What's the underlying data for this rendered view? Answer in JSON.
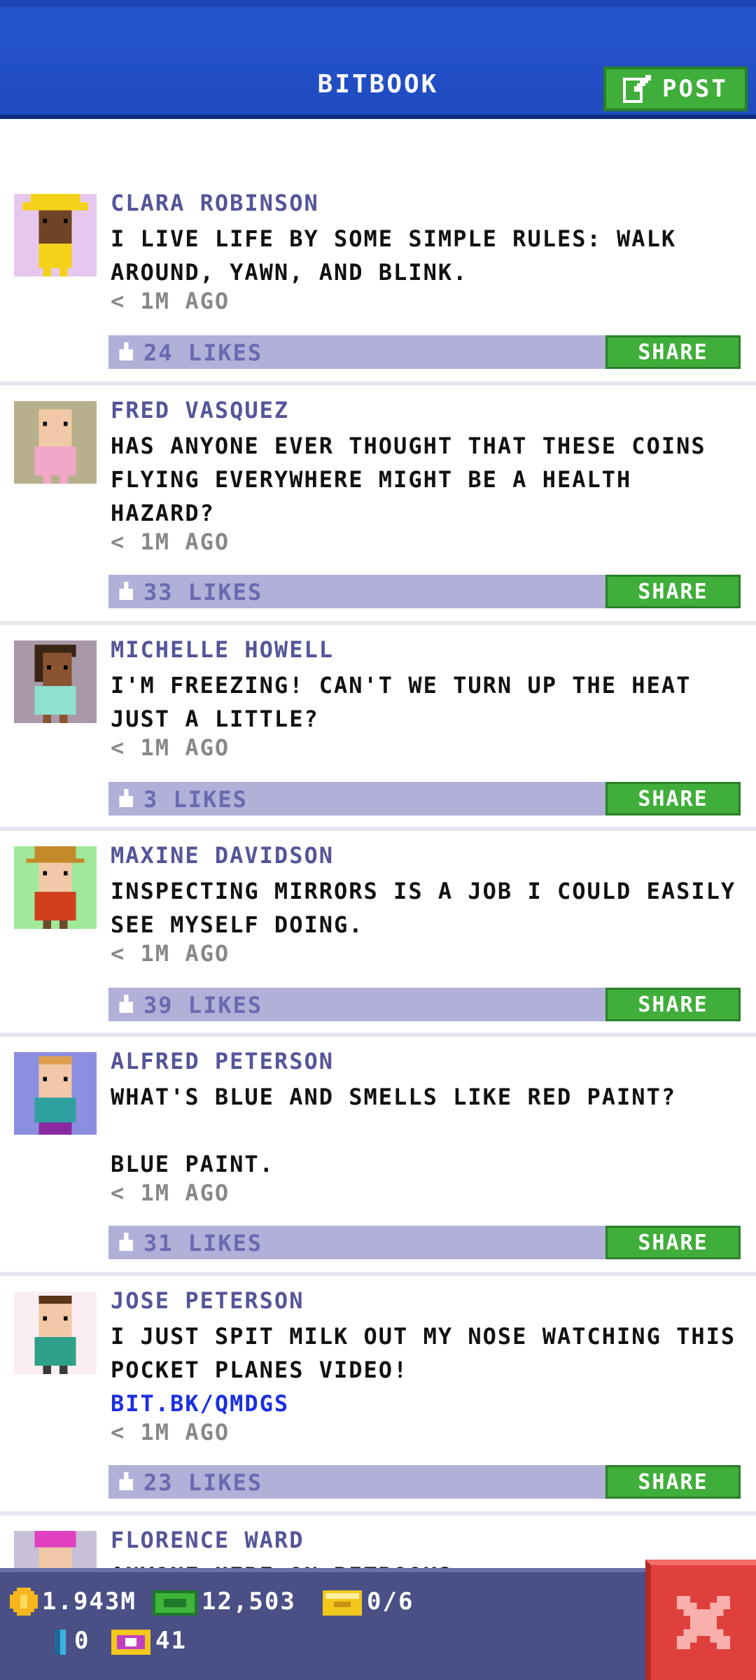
{
  "header": {
    "title": "BITBOOK",
    "post_label": "POST"
  },
  "posts": [
    {
      "author": "CLARA ROBINSON",
      "message": "I LIVE LIFE BY SOME SIMPLE RULES: WALK AROUND, YAWN, AND BLINK.",
      "link": "",
      "time": "< 1M AGO",
      "likes": "24 LIKES",
      "share_label": "SHARE",
      "avatar_bg": "#e6c8ee"
    },
    {
      "author": "FRED VASQUEZ",
      "message": "HAS ANYONE EVER THOUGHT THAT THESE COINS FLYING EVERYWHERE MIGHT BE A HEALTH HAZARD?",
      "link": "",
      "time": "< 1M AGO",
      "likes": "33 LIKES",
      "share_label": "SHARE",
      "avatar_bg": "#b8b08c"
    },
    {
      "author": "MICHELLE HOWELL",
      "message": "I'M FREEZING! CAN'T WE TURN UP THE HEAT JUST A LITTLE?",
      "link": "",
      "time": "< 1M AGO",
      "likes": "3 LIKES",
      "share_label": "SHARE",
      "avatar_bg": "#a898a8"
    },
    {
      "author": "MAXINE DAVIDSON",
      "message": "INSPECTING MIRRORS IS A JOB I COULD EASILY SEE MYSELF DOING.",
      "link": "",
      "time": "< 1M AGO",
      "likes": "39 LIKES",
      "share_label": "SHARE",
      "avatar_bg": "#a0e89a"
    },
    {
      "author": "ALFRED PETERSON",
      "message": "WHAT'S BLUE AND SMELLS LIKE RED PAINT?\n\nBLUE PAINT.",
      "link": "",
      "time": "< 1M AGO",
      "likes": "31 LIKES",
      "share_label": "SHARE",
      "avatar_bg": "#8c8ee0"
    },
    {
      "author": "JOSE PETERSON",
      "message": "I JUST SPIT MILK OUT MY NOSE WATCHING THIS POCKET PLANES VIDEO!",
      "link": "BIT.BK/QMDGS",
      "time": "< 1M AGO",
      "likes": "23 LIKES",
      "share_label": "SHARE",
      "avatar_bg": "#fbeef2"
    },
    {
      "author": "FLORENCE WARD",
      "message": "ANYONE HERE ON BITBOOK?",
      "link": "",
      "time": "",
      "likes": "",
      "share_label": "",
      "avatar_bg": "#c8c0d8"
    }
  ],
  "status": {
    "coins": "1.943M",
    "bux": "12,503",
    "tickets": "0/6",
    "keys": "0",
    "vip": "41"
  },
  "colors": {
    "header": "#1f4bbf",
    "share_green": "#3fae3a",
    "likes_bar": "#b0b0d8",
    "author": "#555599",
    "close_red": "#e0403c"
  }
}
